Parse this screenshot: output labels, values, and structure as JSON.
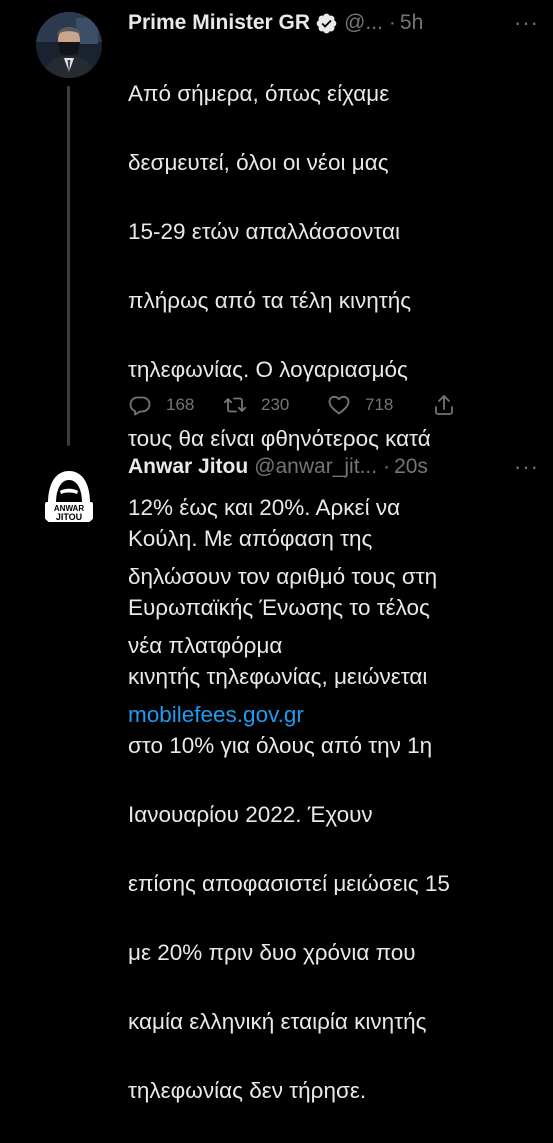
{
  "tweets": [
    {
      "display_name": "Prime Minister GR",
      "handle": "@...",
      "time": "5h",
      "more": "···",
      "text_lines": [
        "Από σήμερα, όπως είχαμε",
        "δεσμευτεί, όλοι οι νέοι μας",
        "15-29 ετών απαλλάσσονται",
        "πλήρως από τα τέλη κινητής",
        "τηλεφωνίας. Ο λογαριασμός",
        "τους θα είναι φθηνότερος κατά",
        "12% έως και 20%. Αρκεί να",
        "δηλώσουν τον αριθμό τους στη",
        "νέα πλατφόρμα"
      ],
      "link": "mobilefees.gov.gr",
      "replies": "168",
      "retweets": "230",
      "likes": "718"
    },
    {
      "display_name": "Anwar Jitou",
      "handle": "@anwar_jit...",
      "time": "20s",
      "more": "···",
      "avatar_text_1": "ANWAR",
      "avatar_text_2": "JITOU",
      "text_lines": [
        "Κούλη. Με απόφαση της",
        "Ευρωπαϊκής Ένωσης το τέλος",
        "κινητής τηλεφωνίας, μειώνεται",
        "στο 10% για όλους από την 1η",
        "Ιανουαρίου 2022. Έχουν",
        "επίσης αποφασιστεί μειώσεις 15",
        "με 20% πριν δυο χρόνια που",
        "καμία ελληνική εταιρία κινητής",
        "τηλεφωνίας δεν τήρησε."
      ]
    }
  ],
  "colors": {
    "background": "#000000",
    "text": "#e7e9ea",
    "muted": "#71767b",
    "link": "#1d9bf0",
    "thread_line": "#3a3d41"
  }
}
